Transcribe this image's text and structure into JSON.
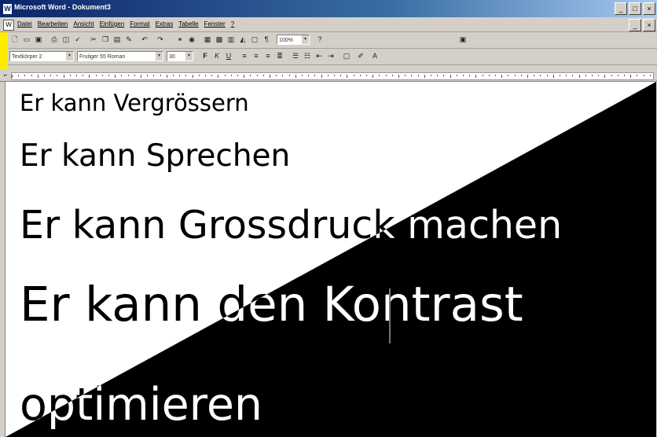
{
  "window": {
    "title": "Microsoft Word - Dokument3",
    "app_icon": "word-icon",
    "buttons": [
      "_",
      "□",
      "×"
    ]
  },
  "menu": {
    "items": [
      "Datei",
      "Bearbeiten",
      "Ansicht",
      "Einfügen",
      "Format",
      "Extras",
      "Tabelle",
      "Fenster",
      "?"
    ],
    "doc_buttons": [
      "_",
      "×"
    ]
  },
  "toolbar_standard": {
    "zoom": "100%"
  },
  "toolbar_format": {
    "style": "Textkörper 2",
    "font": "Frutiger 55 Roman",
    "size": "30",
    "bold": "F",
    "italic": "K",
    "underline": "U"
  },
  "document": {
    "lines": [
      "Er kann Vergrössern",
      "Er kann Sprechen",
      "Er kann Grossdruck machen",
      "Er kann den Kontrast",
      "optimieren"
    ]
  },
  "colors": {
    "title_bar": "#0a246a",
    "highlight_strip": "#ffec00",
    "page": "#ffffff",
    "contrast_half": "#000000"
  }
}
